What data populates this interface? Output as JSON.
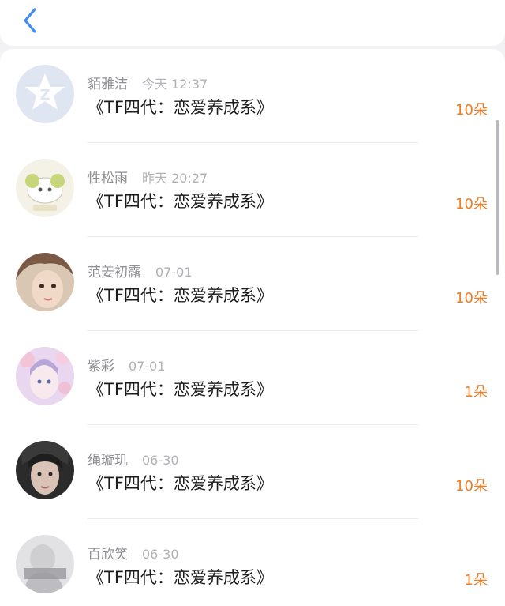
{
  "colors": {
    "accent": "#3a8df4",
    "count": "#ef7e26",
    "name": "#8e8e93",
    "time": "#b1b1b6",
    "title": "#1c1c1e"
  },
  "header": {
    "back_icon": "chevron-left-icon"
  },
  "list": {
    "items": [
      {
        "name": "貊雅洁",
        "time": "今天 12:37",
        "title": "《TF四代：恋爱养成系》",
        "count": "10朵",
        "avatar": "qzone-default-avatar"
      },
      {
        "name": "性松雨",
        "time": "昨天 20:27",
        "title": "《TF四代：恋爱养成系》",
        "count": "10朵",
        "avatar": "cartoon-avatar"
      },
      {
        "name": "范姜初露",
        "time": "07-01",
        "title": "《TF四代：恋爱养成系》",
        "count": "10朵",
        "avatar": "selfie-avatar"
      },
      {
        "name": "紫彩",
        "time": "07-01",
        "title": "《TF四代：恋爱养成系》",
        "count": "1朵",
        "avatar": "anime-avatar"
      },
      {
        "name": "绳璇玑",
        "time": "06-30",
        "title": "《TF四代：恋爱养成系》",
        "count": "10朵",
        "avatar": "portrait-avatar"
      },
      {
        "name": "百欣笑",
        "time": "06-30",
        "title": "《TF四代：恋爱养成系》",
        "count": "1朵",
        "avatar": "photo-avatar"
      }
    ]
  }
}
